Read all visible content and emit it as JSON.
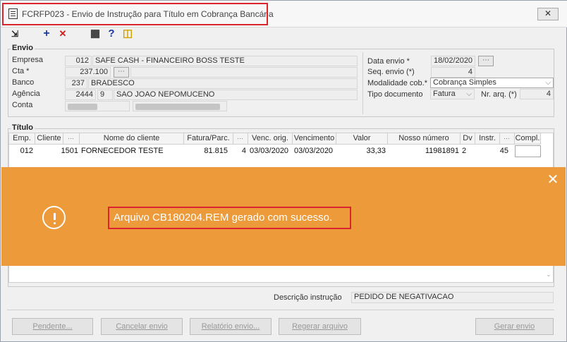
{
  "window": {
    "title": "FCRFP023 - Envio de Instrução para Título em Cobrança Bancária",
    "close_symbol": "✕"
  },
  "toolbar": {
    "icons": [
      {
        "name": "exit-icon",
        "glyph": "⇲",
        "color": "#1f1f1f"
      },
      {
        "name": "add-icon",
        "glyph": "+",
        "color": "#1c3c9e"
      },
      {
        "name": "delete-icon",
        "glyph": "✕",
        "color": "#d61b1b"
      },
      {
        "name": "calendar-grid-icon",
        "glyph": "▦",
        "color": "#333333"
      },
      {
        "name": "help-icon",
        "glyph": "?",
        "color": "#1a36a8"
      },
      {
        "name": "door-exit-icon",
        "glyph": "◫",
        "color": "#d2a300"
      }
    ]
  },
  "envio": {
    "group_label": "Envio",
    "empresa_label": "Empresa",
    "empresa_code": "012",
    "empresa_name": "SAFE CASH - FINANCEIRO BOSS TESTE",
    "cta_label": "Cta *",
    "cta_value": "237.100",
    "banco_label": "Banco",
    "banco_code": "237",
    "banco_name": "BRADESCO",
    "agencia_label": "Agência",
    "agencia_code": "2444",
    "agencia_digit": "9",
    "agencia_name": "SAO JOAO NEPOMUCENO",
    "conta_label": "Conta",
    "data_envio_label": "Data envio *",
    "data_envio_value": "18/02/2020",
    "seq_envio_label": "Seq. envio (*)",
    "seq_envio_value": "4",
    "modalidade_label": "Modalidade cob.*",
    "modalidade_value": "Cobrança Simples",
    "tipo_doc_label": "Tipo documento",
    "tipo_doc_value": "Fatura",
    "nr_arq_label": "Nr. arq. (*)",
    "nr_arq_value": "4"
  },
  "titulo": {
    "group_label": "Título",
    "columns": [
      "Emp.",
      "Cliente",
      "",
      "Nome do cliente",
      "Fatura/Parc.",
      "",
      "Venc. orig.",
      "Vencimento",
      "Valor",
      "Nosso número",
      "Dv",
      "Instr.",
      "",
      "Compl."
    ],
    "rows": [
      [
        "012",
        "1501",
        "FORNECEDOR TESTE",
        "81.815",
        "4",
        "03/03/2020",
        "03/03/2020",
        "33,33",
        "11981891",
        "2",
        "45"
      ]
    ]
  },
  "notification": {
    "message": "Arquivo CB180204.REM gerado com sucesso.",
    "close_symbol": "✕"
  },
  "descricao": {
    "label": "Descrição instrução",
    "value": "PEDIDO DE NEGATIVACAO"
  },
  "footer": {
    "pendente": "Pendente...",
    "cancelar": "Cancelar envio",
    "relatorio": "Relatório envio...",
    "regerar": "Regerar arquivo",
    "gerar": "Gerar envio"
  }
}
